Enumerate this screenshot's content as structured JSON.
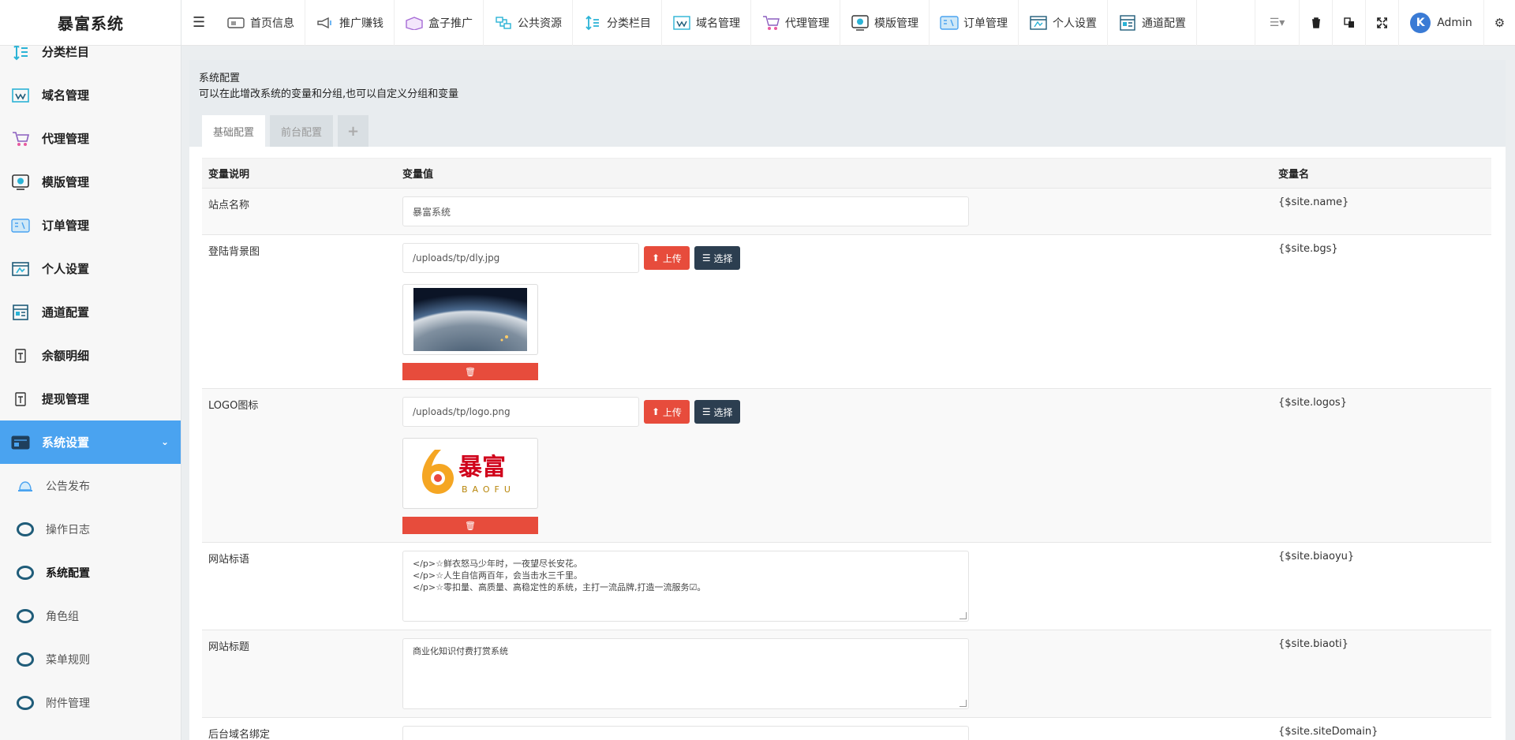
{
  "brand": "暴富系统",
  "sidebar": {
    "items": [
      {
        "label": "分类栏目",
        "icon": "sort-icon"
      },
      {
        "label": "域名管理",
        "icon": "domain-icon"
      },
      {
        "label": "代理管理",
        "icon": "cart-icon"
      },
      {
        "label": "模版管理",
        "icon": "template-icon"
      },
      {
        "label": "订单管理",
        "icon": "order-icon"
      },
      {
        "label": "个人设置",
        "icon": "profile-icon"
      },
      {
        "label": "通道配置",
        "icon": "channel-icon"
      },
      {
        "label": "余额明细",
        "icon": "balance-icon"
      },
      {
        "label": "提现管理",
        "icon": "withdraw-icon"
      },
      {
        "label": "系统设置",
        "icon": "settings-icon"
      }
    ],
    "sub": [
      {
        "label": "公告发布",
        "icon": "bell-icon"
      },
      {
        "label": "操作日志",
        "icon": "ring-icon"
      },
      {
        "label": "系统配置",
        "icon": "ring-icon"
      },
      {
        "label": "角色组",
        "icon": "ring-icon"
      },
      {
        "label": "菜单规则",
        "icon": "ring-icon"
      },
      {
        "label": "附件管理",
        "icon": "ring-icon"
      }
    ]
  },
  "topnav": [
    {
      "label": "首页信息",
      "icon": "home-icon"
    },
    {
      "label": "推广赚钱",
      "icon": "megaphone-icon"
    },
    {
      "label": "盒子推广",
      "icon": "box-icon"
    },
    {
      "label": "公共资源",
      "icon": "resource-icon"
    },
    {
      "label": "分类栏目",
      "icon": "sort-icon"
    },
    {
      "label": "域名管理",
      "icon": "domain-icon"
    },
    {
      "label": "代理管理",
      "icon": "cart-icon"
    },
    {
      "label": "模版管理",
      "icon": "template-icon"
    },
    {
      "label": "订单管理",
      "icon": "order-icon"
    },
    {
      "label": "个人设置",
      "icon": "profile-icon"
    },
    {
      "label": "通道配置",
      "icon": "channel-icon"
    }
  ],
  "user": {
    "name": "Admin",
    "avatar_letter": "K"
  },
  "panel": {
    "title": "系统配置",
    "desc": "可以在此增改系统的变量和分组,也可以自定义分组和变量",
    "tabs": [
      "基础配置",
      "前台配置",
      "+"
    ]
  },
  "table": {
    "headers": [
      "变量说明",
      "变量值",
      "变量名"
    ],
    "rows": {
      "name": {
        "label": "站点名称",
        "value": "暴富系统",
        "var": "{$site.name}"
      },
      "bgs": {
        "label": "登陆背景图",
        "value": "/uploads/tp/dly.jpg",
        "var": "{$site.bgs}"
      },
      "logos": {
        "label": "LOGO图标",
        "value": "/uploads/tp/logo.png",
        "var": "{$site.logos}",
        "logo_text": "暴富",
        "logo_sub": "BAOFU"
      },
      "biaoyu": {
        "label": "网站标语",
        "value": "</p>☆鲜衣怒马少年时，一夜望尽长安花。\n</p>☆人生自信两百年，会当击水三千里。\n</p>☆零扣量、高质量、高稳定性的系统，主打一流品牌,打造一流服务☑。",
        "var": "{$site.biaoyu}"
      },
      "biaoti": {
        "label": "网站标题",
        "value": "商业化知识付费打赏系统",
        "var": "{$site.biaoti}"
      },
      "domain": {
        "label": "后台域名绑定",
        "value": "",
        "var": "{$site.siteDomain}"
      }
    },
    "upload_label": "上传",
    "choose_label": "选择"
  },
  "colors": {
    "accent": "#4aa3f0",
    "danger": "#e74c3c",
    "dark": "#2c3e50"
  }
}
